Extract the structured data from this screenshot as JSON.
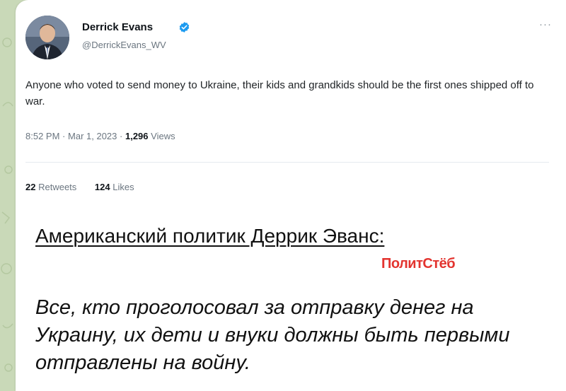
{
  "tweet": {
    "author_name": "Derrick Evans",
    "handle": "@DerrickEvans_WV",
    "more_label": "···",
    "text": "Anyone who voted to send money to Ukraine, their kids and grandkids should be the first ones shipped off to war.",
    "time": "8:52 PM",
    "date": "Mar 1, 2023",
    "separator": "·",
    "views_count": "1,296",
    "views_label": "Views",
    "retweets_count": "22",
    "retweets_label": "Retweets",
    "likes_count": "124",
    "likes_label": "Likes",
    "verified_icon": "verified-badge-icon"
  },
  "caption": {
    "headline": "Американский политик Деррик Эванс:",
    "watermark": "ПолитСтёб",
    "quote": "Все, кто проголосовал за отправку денег на Украину, их дети и внуки должны быть первыми отправлены на войну."
  },
  "colors": {
    "background": "#c9d9b8",
    "verified": "#1d9bf0",
    "watermark": "#e3342f",
    "muted_text": "#6b7680"
  }
}
